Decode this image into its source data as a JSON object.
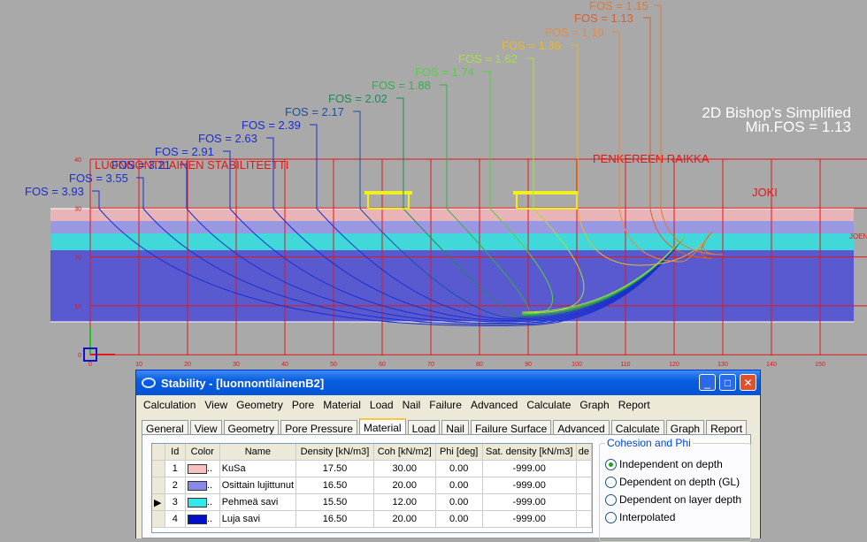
{
  "drawing": {
    "method_label": "2D Bishop's Simplified",
    "min_fos_label": "Min.FOS = 1.13",
    "section_title": "LUONNONTILAINEN STABILITEETTI",
    "embankment_label": "PENKEREEN RAIKKA",
    "river_label": "JOKI",
    "river_edge_label": "JOEN",
    "x_ticks": [
      "0",
      "10",
      "20",
      "30",
      "40",
      "50",
      "60",
      "70",
      "80",
      "90",
      "100",
      "110",
      "120",
      "130",
      "140",
      "150"
    ],
    "y_ticks": [
      "40",
      "30",
      "20",
      "10",
      "0"
    ],
    "fos_labels": [
      {
        "text": "FOS = 3.93",
        "color": "#1a2fd0"
      },
      {
        "text": "FOS = 3.55",
        "color": "#1a2fd0"
      },
      {
        "text": "FOS = 3.21",
        "color": "#1a2fd0"
      },
      {
        "text": "FOS = 2.91",
        "color": "#1a2fd0"
      },
      {
        "text": "FOS = 2.63",
        "color": "#1a2fd0"
      },
      {
        "text": "FOS = 2.39",
        "color": "#1a2fd0"
      },
      {
        "text": "FOS = 2.17",
        "color": "#1a4fa8"
      },
      {
        "text": "FOS = 2.02",
        "color": "#1f8a5a"
      },
      {
        "text": "FOS = 1.88",
        "color": "#33b04a"
      },
      {
        "text": "FOS = 1.74",
        "color": "#55d040"
      },
      {
        "text": "FOS = 1.62",
        "color": "#a8e040"
      },
      {
        "text": "FOS = 1.36",
        "color": "#e8b830"
      },
      {
        "text": "FOS = 1.19",
        "color": "#e88a40"
      },
      {
        "text": "FOS = 1.13",
        "color": "#d86030"
      },
      {
        "text": "FOS = 1.15",
        "color": "#e07a30"
      }
    ],
    "layer_colors": [
      "#e8b4b8",
      "#9a98e0",
      "#40d8d8",
      "#5a5ad0"
    ]
  },
  "dialog": {
    "title": "Stability - [luonnontilainenB2]",
    "menu": [
      "Calculation",
      "View",
      "Geometry",
      "Pore",
      "Material",
      "Load",
      "Nail",
      "Failure",
      "Advanced",
      "Calculate",
      "Graph",
      "Report"
    ],
    "tabs": [
      "General",
      "View",
      "Geometry",
      "Pore Pressure",
      "Material",
      "Load",
      "Nail",
      "Failure Surface",
      "Advanced",
      "Calculate",
      "Graph",
      "Report"
    ],
    "active_tab": "Material",
    "columns": [
      "Id",
      "Color",
      "Name",
      "Density [kN/m3]",
      "Coh [kN/m2]",
      "Phi [deg]",
      "Sat. density [kN/m3]",
      "de"
    ],
    "rows": [
      {
        "id": "1",
        "color": "#f8c0c0",
        "name": "KuSa",
        "density": "17.50",
        "coh": "30.00",
        "phi": "0.00",
        "sat": "-999.00"
      },
      {
        "id": "2",
        "color": "#8888e8",
        "name": "Osittain lujittunut",
        "density": "16.50",
        "coh": "20.00",
        "phi": "0.00",
        "sat": "-999.00"
      },
      {
        "id": "3",
        "color": "#30e8e8",
        "name": "Pehmeä savi",
        "density": "15.50",
        "coh": "12.00",
        "phi": "0.00",
        "sat": "-999.00"
      },
      {
        "id": "4",
        "color": "#0010c8",
        "name": "Luja savi",
        "density": "16.50",
        "coh": "20.00",
        "phi": "0.00",
        "sat": "-999.00"
      }
    ],
    "selected_row": "3",
    "group_title": "Cohesion and Phi",
    "options": [
      "Independent on depth",
      "Dependent on depth (GL)",
      "Dependent on layer depth",
      "Interpolated"
    ],
    "selected_option": "Independent on depth"
  }
}
